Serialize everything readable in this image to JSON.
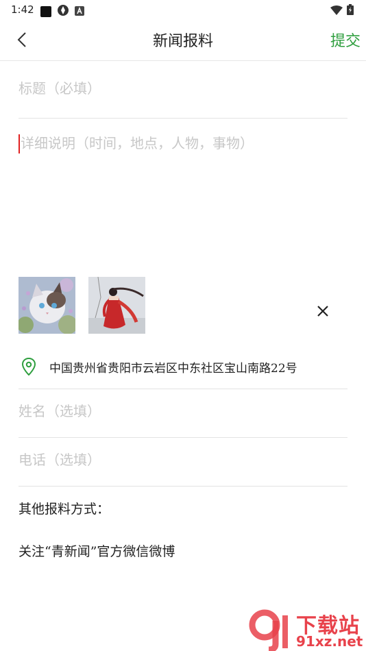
{
  "status_bar": {
    "time": "1:42"
  },
  "nav": {
    "title": "新闻报料",
    "submit_label": "提交"
  },
  "form": {
    "title_placeholder": "标题（必填）",
    "detail_placeholder": "详细说明（时间，地点，人物，事物）",
    "location": "中国贵州省贵阳市云岩区中东社区宝山南路22号",
    "name_placeholder": "姓名（选填）",
    "phone_placeholder": "电话（选填）"
  },
  "photos": [
    {
      "name": "cat-photo"
    },
    {
      "name": "woman-red-dress-photo"
    }
  ],
  "other": {
    "heading": "其他报料方式：",
    "follow": "关注“青新闻”官方微信微博"
  },
  "watermark": {
    "cn": "下载站",
    "en": "91xz.net"
  },
  "colors": {
    "accent_green": "#2e9e3e",
    "placeholder_gray": "#c7c7c7",
    "divider": "#e3e3e3",
    "caret_red": "#e02020",
    "watermark_red": "#e8424b"
  }
}
